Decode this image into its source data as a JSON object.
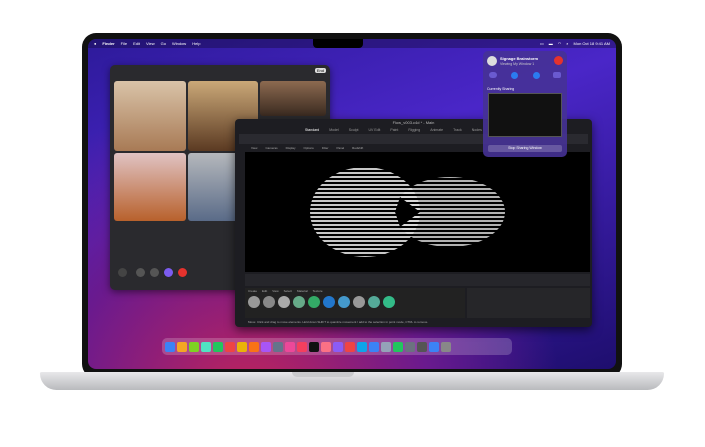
{
  "menubar": {
    "apple": "",
    "items": [
      "Finder",
      "File",
      "Edit",
      "View",
      "Go",
      "Window",
      "Help"
    ],
    "clock": "Mon Oct 18  9:41 AM"
  },
  "facetime": {
    "end_label": "End"
  },
  "c4d": {
    "title": "Flow_v003.c4d * - Main",
    "file_tab": "Flow_v003.c4d*",
    "tabs": [
      "Standard",
      "Model",
      "Sculpt",
      "UV Edit",
      "Paint",
      "Rigging",
      "Animate",
      "Track",
      "Nodes"
    ],
    "menu": [
      "View",
      "Cameras",
      "Display",
      "Options",
      "Filter",
      "Panel",
      "Redshift"
    ],
    "mat_menu": [
      "Create",
      "Edit",
      "View",
      "Select",
      "Material",
      "Texture"
    ],
    "status": "Move: Click and drag to move elements. Hold down SHIFT to quantize movement / add to the selection in point mode, CTRL to remove."
  },
  "share": {
    "title": "Signage Brainstorm",
    "subtitle": "Viewing My Window 1",
    "section": "Currently Sharing",
    "stop": "Stop Sharing Window"
  },
  "dock_colors": [
    "#3b82f6",
    "#f5a623",
    "#7ed321",
    "#50e3c2",
    "#22c55e",
    "#ef4444",
    "#eab308",
    "#f97316",
    "#a855f7",
    "#64748b",
    "#ec4899",
    "#f43f5e",
    "#111",
    "#fb7185",
    "#8b5cf6",
    "#ef4444",
    "#0ea5e9",
    "#3b82f6",
    "#94a3b8",
    "#22c55e",
    "#6b7280",
    "#555",
    "#3b82f6",
    "#888"
  ]
}
